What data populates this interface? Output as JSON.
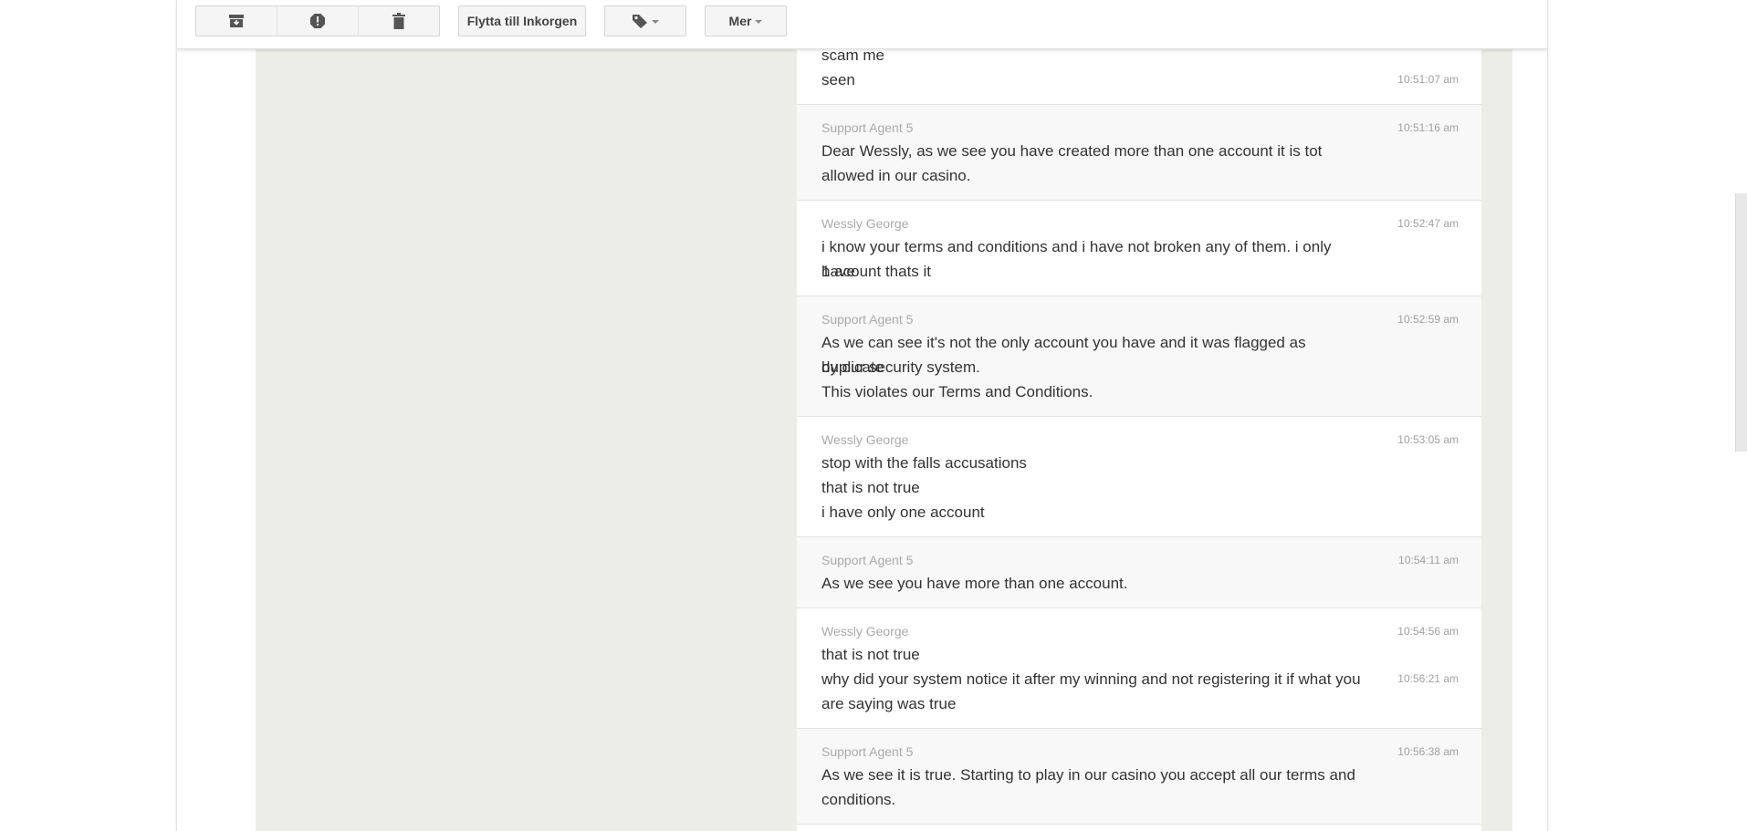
{
  "toolbar": {
    "move_to_inbox_label": "Flytta till Inkorgen",
    "more_label": "Mer",
    "icons": [
      "archive-icon",
      "report-spam-icon",
      "delete-icon",
      "label-icon"
    ]
  },
  "colors": {
    "thread_bg": "#ffffff",
    "alt_row_bg": "#f8f8f8",
    "side_bg": "#edede7",
    "sender_color": "#aaaaaa",
    "text_color": "#333333"
  },
  "messages": [
    {
      "sender": "",
      "lines": [
        "scam me",
        "seen"
      ],
      "times": [
        "",
        "10:51:07 am"
      ]
    },
    {
      "sender": "Support Agent 5",
      "lines": [
        "Dear Wessly, as we see you have created more than one account it is tot",
        "allowed in our casino."
      ],
      "times": [
        "10:51:16 am"
      ]
    },
    {
      "sender": "Wessly George",
      "lines": [
        "i know your terms and conditions and i have not broken any of them. i only have",
        "1 acount thats it"
      ],
      "times": [
        "10:52:47 am"
      ]
    },
    {
      "sender": "Support Agent 5",
      "lines": [
        "As we can see it's not the only account you have and it was flagged as duplicate",
        "by our security system.",
        "This violates our Terms and Conditions."
      ],
      "times": [
        "10:52:59 am"
      ]
    },
    {
      "sender": "Wessly George",
      "lines": [
        "stop with the falls accusations",
        "that is not true",
        "i have only one account"
      ],
      "times": [
        "10:53:05 am"
      ]
    },
    {
      "sender": "Support Agent 5",
      "lines": [
        "As we see you have more than one account."
      ],
      "times": [
        "10:54:11 am"
      ]
    },
    {
      "sender": "Wessly George",
      "lines": [
        "that is not true",
        "why did your system notice it after my winning and not registering it if what you",
        "are saying was true"
      ],
      "times": [
        "10:54:56 am",
        "10:56:21 am"
      ]
    },
    {
      "sender": "Support Agent 5",
      "lines": [
        "As we see it is true. Starting to play in our casino you accept all our terms and",
        "conditions."
      ],
      "times": [
        "10:56:38 am"
      ]
    }
  ]
}
